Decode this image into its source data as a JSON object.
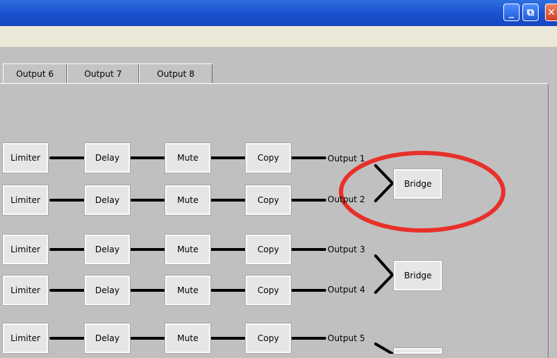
{
  "window": {
    "buttons": [
      {
        "name": "minimize",
        "glyph": "_"
      },
      {
        "name": "restore",
        "glyph": "⧉"
      },
      {
        "name": "close",
        "glyph": "✕"
      }
    ]
  },
  "tabs": [
    "Output 6",
    "Output 7",
    "Output 8"
  ],
  "chain": {
    "limiter": "Limiter",
    "delay": "Delay",
    "mute": "Mute",
    "copy": "Copy"
  },
  "outputs": [
    "Output 1",
    "Output 2",
    "Output 3",
    "Output 4",
    "Output 5"
  ],
  "bridge": "Bridge",
  "highlight_color": "#e8302a"
}
